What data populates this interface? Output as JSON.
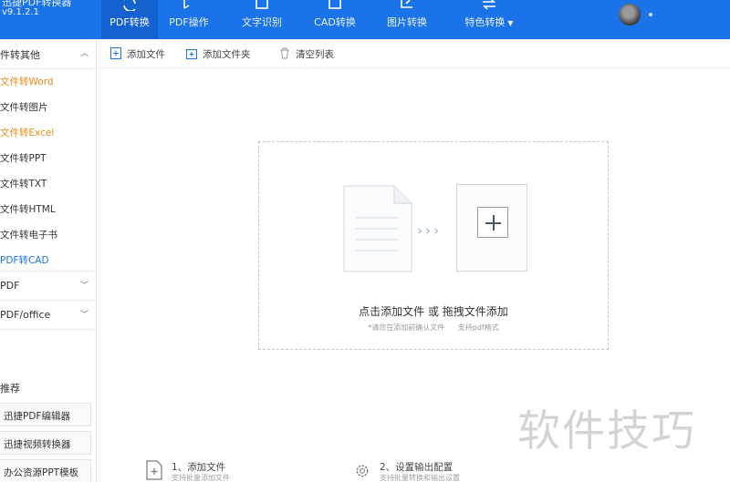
{
  "app": {
    "title_partial": "迅捷PDF转换器",
    "version": "v9.1.2.1"
  },
  "nav": {
    "items": [
      {
        "label": "PDF转换",
        "active": true
      },
      {
        "label": "PDF操作",
        "active": false
      },
      {
        "label": "文字识别",
        "active": false
      },
      {
        "label": "CAD转换",
        "active": false
      },
      {
        "label": "图片转换",
        "active": false
      },
      {
        "label": "特色转换",
        "active": false,
        "has_dropdown": true
      }
    ]
  },
  "sidebar": {
    "groups": [
      {
        "label": "件转其他",
        "expanded": true
      },
      {
        "label": "PDF",
        "expanded": false
      },
      {
        "label": "PDF/office",
        "expanded": false
      }
    ],
    "items": [
      {
        "label": "文件转Word",
        "color": "#e8891a"
      },
      {
        "label": "文件转图片",
        "color": "#333333"
      },
      {
        "label": "文件转Excel",
        "color": "#e8891a"
      },
      {
        "label": "文件转PPT",
        "color": "#333333"
      },
      {
        "label": "文件转TXT",
        "color": "#333333"
      },
      {
        "label": "文件转HTML",
        "color": "#333333"
      },
      {
        "label": "文件转电子书",
        "color": "#333333"
      },
      {
        "label": "PDF转CAD",
        "color": "#1a73e8"
      }
    ],
    "recommend": {
      "title": "推荐",
      "items": [
        {
          "label": "迅捷PDF编辑器"
        },
        {
          "label": "迅捷视频转换器"
        },
        {
          "label": "办公资源PPT模板"
        }
      ]
    }
  },
  "toolbar": {
    "add_file": "添加文件",
    "add_folder": "添加文件夹",
    "clear_list": "清空列表"
  },
  "dropzone": {
    "main_text": "点击添加文件 或 拖拽文件添加",
    "sub_text_1": "*请您在添加前确认文件",
    "sub_text_2": "支持pdf格式"
  },
  "steps": [
    {
      "title": "1、添加文件",
      "desc": "支持批量添加文件"
    },
    {
      "title": "2、设置输出配置",
      "desc": "支持批量转换和输出设置"
    }
  ],
  "watermark": "软件技巧",
  "colors": {
    "primary": "#1a73e8",
    "active_tab": "#1462cf",
    "accent_orange": "#e8891a"
  }
}
